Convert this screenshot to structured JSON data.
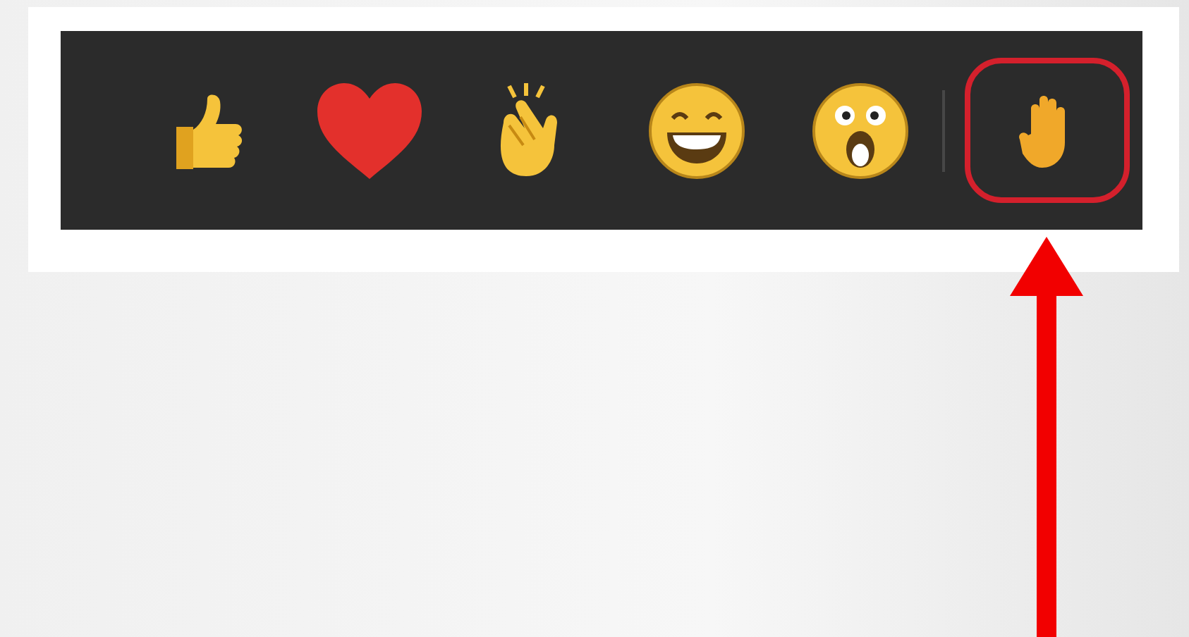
{
  "reactions": [
    {
      "kind": "like"
    },
    {
      "kind": "heart"
    },
    {
      "kind": "clap"
    },
    {
      "kind": "laugh"
    },
    {
      "kind": "surprised"
    }
  ],
  "raise_hand": {
    "highlighted": true
  }
}
